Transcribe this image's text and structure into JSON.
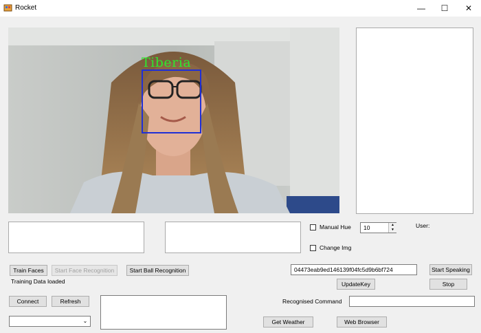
{
  "window": {
    "title": "Rocket",
    "controls": {
      "minimize": "—",
      "maximize": "☐",
      "close": "✕"
    }
  },
  "camera": {
    "recognized_name": "Tiberia",
    "box_color": "#1f2fd6",
    "label_color": "#2ee82e"
  },
  "controls": {
    "manual_hue_label": "Manual Hue",
    "change_img_label": "Change Img",
    "hue_value": "10",
    "user_label": "User:"
  },
  "buttons": {
    "train_faces": "Train Faces",
    "start_face_recognition": "Start Face Recognition",
    "start_ball_recognition": "Start Ball Recognition",
    "start_speaking": "Start Speaking",
    "update_key": "UpdateKey",
    "stop": "Stop",
    "connect": "Connect",
    "refresh": "Refresh",
    "get_weather": "Get Weather",
    "web_browser": "Web Browser"
  },
  "status": {
    "training": "Training Data loaded"
  },
  "api_key": "04473eab9ed146139f04fc5d9b6bf724",
  "recognised_command_label": "Recognised Command",
  "recognised_command_value": "",
  "port_select_value": ""
}
